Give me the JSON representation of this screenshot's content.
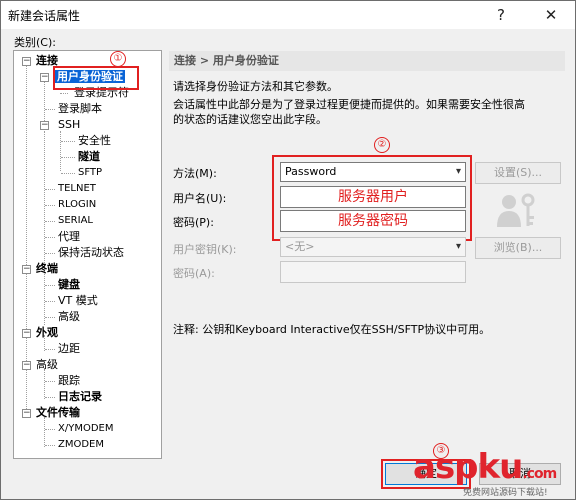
{
  "window": {
    "title": "新建会话属性",
    "help_glyph": "?",
    "close_glyph": "✕"
  },
  "category_label": "类别(C):",
  "tree": {
    "items": [
      {
        "label": "连接",
        "bold": true
      },
      {
        "label": "用户身份验证",
        "bold": true,
        "selected": true
      },
      {
        "label": "登录提示符"
      },
      {
        "label": "登录脚本"
      },
      {
        "label": "SSH"
      },
      {
        "label": "安全性"
      },
      {
        "label": "隧道",
        "bold": true
      },
      {
        "label": "SFTP"
      },
      {
        "label": "TELNET"
      },
      {
        "label": "RLOGIN"
      },
      {
        "label": "SERIAL"
      },
      {
        "label": "代理"
      },
      {
        "label": "保持活动状态"
      },
      {
        "label": "终端",
        "bold": true
      },
      {
        "label": "键盘",
        "bold": true
      },
      {
        "label": "VT 模式"
      },
      {
        "label": "高级"
      },
      {
        "label": "外观",
        "bold": true
      },
      {
        "label": "边距"
      },
      {
        "label": "高级"
      },
      {
        "label": "跟踪"
      },
      {
        "label": "日志记录",
        "bold": true
      },
      {
        "label": "文件传输",
        "bold": true
      },
      {
        "label": "X/YMODEM"
      },
      {
        "label": "ZMODEM"
      }
    ]
  },
  "panel": {
    "breadcrumb": "连接 > 用户身份验证",
    "desc1": "请选择身份验证方法和其它参数。",
    "desc2": "会话属性中此部分是为了登录过程更便捷而提供的。如果需要安全性很高",
    "desc3": "的状态的话建议您空出此字段。",
    "method_label": "方法(M):",
    "method_value": "Password",
    "settings_button": "设置(S)...",
    "username_label": "用户名(U):",
    "username_value": "服务器用户",
    "password_label": "密码(P):",
    "password_value": "服务器密码",
    "userkey_label": "用户密钥(K):",
    "userkey_value": "<无>",
    "browse_button": "浏览(B)...",
    "passphrase_label": "密码(A):",
    "note": "注释: 公钥和Keyboard Interactive仅在SSH/SFTP协议中可用。"
  },
  "annotations": {
    "n1": "①",
    "n2": "②",
    "n3": "③"
  },
  "footer": {
    "ok_button": "确定",
    "cancel_button": "取消"
  },
  "watermark": {
    "logo": "aspku",
    "logo_suffix": ".com",
    "sub": "免费网站源码下载站!"
  },
  "colors": {
    "annotation": "#e12020",
    "selection": "#0a64d6"
  }
}
